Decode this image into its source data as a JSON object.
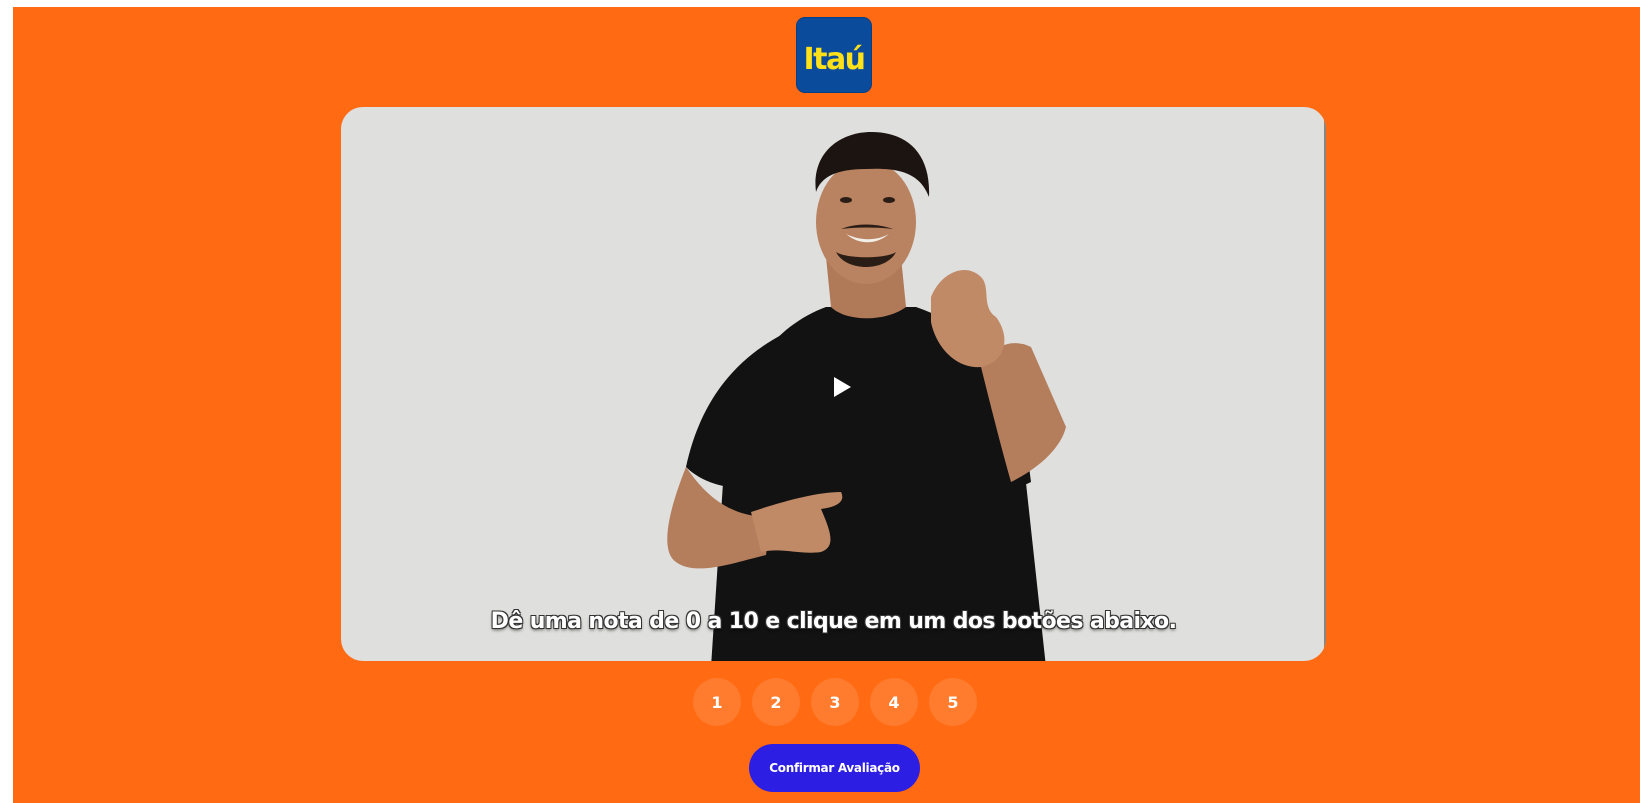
{
  "brand": {
    "logo_text": "Itaú",
    "logo_bg": "#0a4b9c",
    "logo_fg": "#ffe11a"
  },
  "colors": {
    "page_bg": "#ff6a12",
    "video_bg": "#dfdfdd",
    "rating_bg": "#ff7c2e",
    "confirm_bg": "#2d1ee3"
  },
  "video": {
    "subtitle": "Dê uma nota de 0 a 10 e clique em um dos botões abaixo.",
    "play_icon": "play-icon"
  },
  "ratings": {
    "options": [
      "1",
      "2",
      "3",
      "4",
      "5"
    ]
  },
  "confirm": {
    "label": "Confirmar Avaliação"
  }
}
